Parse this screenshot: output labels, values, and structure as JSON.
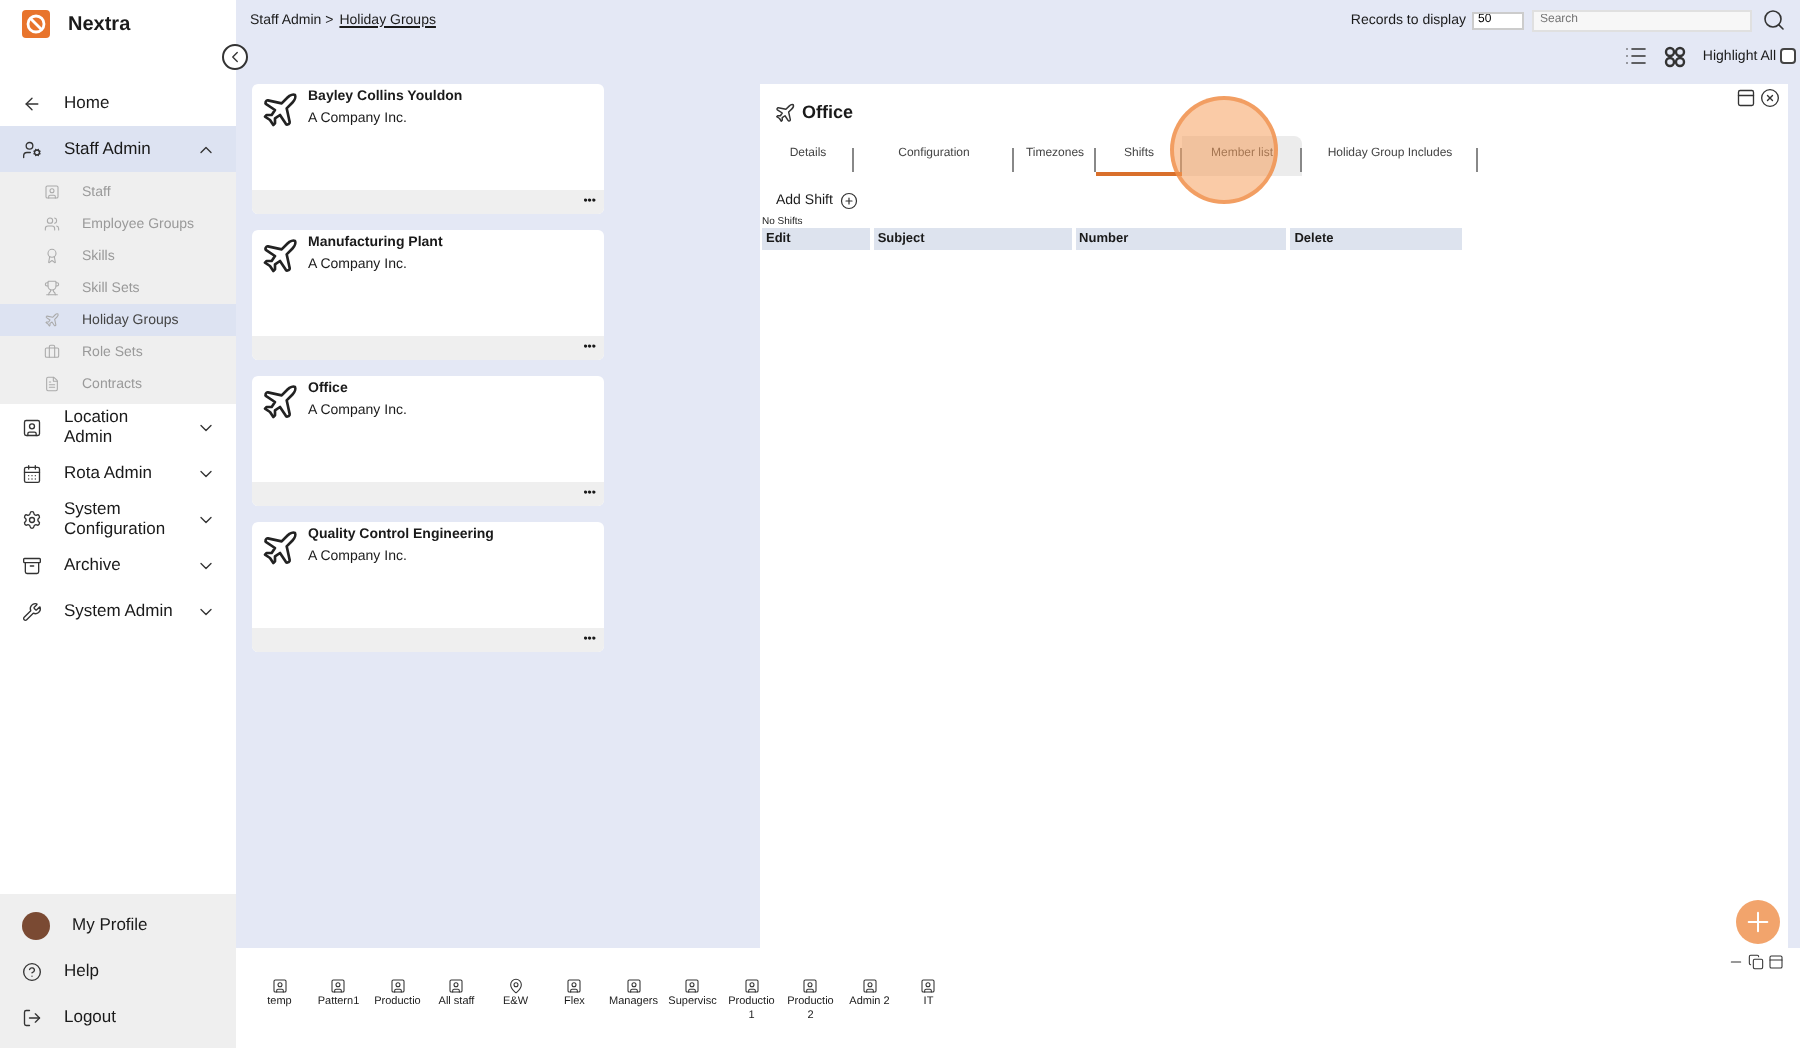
{
  "app": {
    "name": "Nextra"
  },
  "sidebar": {
    "items": [
      {
        "label": "Home",
        "kind": "link"
      },
      {
        "label": "Staff Admin",
        "kind": "group",
        "expanded": true,
        "children": [
          {
            "label": "Staff",
            "selected": false
          },
          {
            "label": "Employee Groups",
            "selected": false
          },
          {
            "label": "Skills",
            "selected": false
          },
          {
            "label": "Skill Sets",
            "selected": false
          },
          {
            "label": "Holiday Groups",
            "selected": true
          },
          {
            "label": "Role Sets",
            "selected": false
          },
          {
            "label": "Contracts",
            "selected": false
          }
        ]
      },
      {
        "label": "Location Admin",
        "kind": "group",
        "expanded": false
      },
      {
        "label": "Rota Admin",
        "kind": "group",
        "expanded": false
      },
      {
        "label": "System Configuration",
        "kind": "group",
        "expanded": false
      },
      {
        "label": "Archive",
        "kind": "group",
        "expanded": false
      },
      {
        "label": "System Admin",
        "kind": "group",
        "expanded": false
      }
    ],
    "footer": [
      {
        "label": "My Profile"
      },
      {
        "label": "Help"
      },
      {
        "label": "Logout"
      }
    ]
  },
  "breadcrumb": {
    "items": [
      "Staff Admin",
      "Holiday Groups"
    ],
    "separator": ">"
  },
  "toolbar": {
    "records_label": "Records to display",
    "records_value": "50",
    "search": {
      "placeholder": "Search"
    },
    "highlight_all": {
      "label": "Highlight All",
      "checked": false
    }
  },
  "cards": [
    {
      "title": "Bayley Collins Youldon",
      "subtitle": "A Company Inc.",
      "menu": "•••"
    },
    {
      "title": "Manufacturing Plant",
      "subtitle": "A Company Inc.",
      "menu": "•••"
    },
    {
      "title": "Office",
      "subtitle": "A Company Inc.",
      "menu": "•••"
    },
    {
      "title": "Quality Control Engineering",
      "subtitle": "A Company Inc.",
      "menu": "•••"
    }
  ],
  "detail": {
    "title": "Office",
    "tabs": [
      {
        "label": "Details",
        "selected": false,
        "hovered": false
      },
      {
        "label": "Configuration",
        "selected": false,
        "hovered": false
      },
      {
        "label": "Timezones",
        "selected": false,
        "hovered": false
      },
      {
        "label": "Shifts",
        "selected": true,
        "hovered": false
      },
      {
        "label": "Member list",
        "selected": false,
        "hovered": true
      },
      {
        "label": "Holiday Group Includes",
        "selected": false,
        "hovered": false
      }
    ],
    "add_label": "Add Shift",
    "empty_message": "No Shifts",
    "table": {
      "columns": [
        "Edit",
        "Subject",
        "Number",
        "Delete"
      ]
    }
  },
  "dock": [
    {
      "label": "temp",
      "kind": "group"
    },
    {
      "label": "Pattern1",
      "kind": "group"
    },
    {
      "label": "Productio",
      "kind": "group"
    },
    {
      "label": "All staff",
      "kind": "group"
    },
    {
      "label": "E&W",
      "kind": "location"
    },
    {
      "label": "Flex",
      "kind": "group"
    },
    {
      "label": "Managers",
      "kind": "group"
    },
    {
      "label": "Supervisc",
      "kind": "group"
    },
    {
      "label": "Productio 1",
      "kind": "group"
    },
    {
      "label": "Productio 2",
      "kind": "group"
    },
    {
      "label": "Admin 2",
      "kind": "group"
    },
    {
      "label": "IT",
      "kind": "group"
    }
  ]
}
